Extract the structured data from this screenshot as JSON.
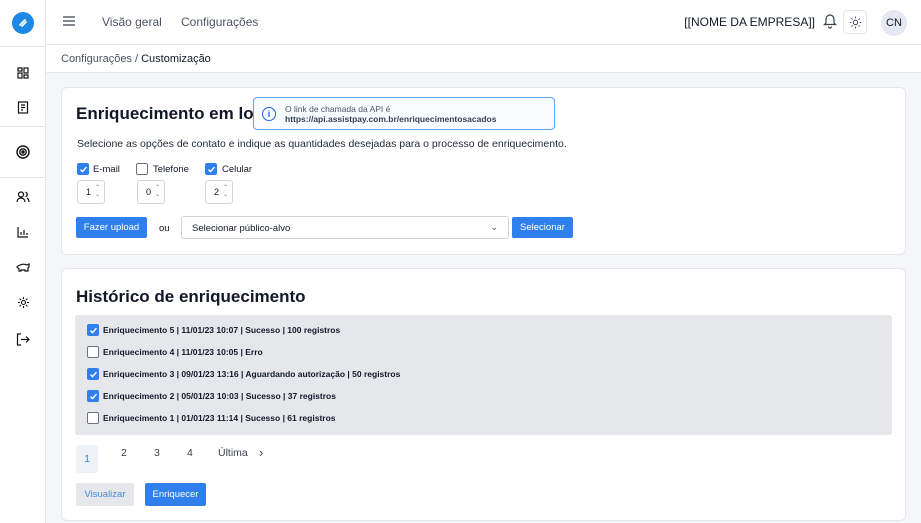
{
  "topbar": {
    "nav": [
      "Visão geral",
      "Configurações"
    ],
    "company": "[[NOME DA EMPRESA]]",
    "avatar": "CN"
  },
  "sidebar": {
    "icons": [
      "logo-icon",
      "dashboard-icon",
      "invoice-icon",
      "target-icon",
      "users-icon",
      "chart-icon",
      "piggy-bank-icon",
      "settings-icon",
      "logout-icon"
    ]
  },
  "breadcrumb": {
    "parent": "Configurações",
    "separator": " / ",
    "current": "Customização"
  },
  "batch": {
    "title": "Enriquecimento em lote",
    "info_line1": "O link de chamada da API é",
    "info_url": "https://api.assistpay.com.br/enriquecimentosacados",
    "description": "Selecione as opções de contato e indique as quantidades desejadas para o processo de enriquecimento.",
    "options": [
      {
        "label": "E-mail",
        "checked": true,
        "qty": "1"
      },
      {
        "label": "Telefone",
        "checked": false,
        "qty": "0"
      },
      {
        "label": "Celular",
        "checked": true,
        "qty": "2"
      }
    ],
    "upload_label": "Fazer upload",
    "or_label": "ou",
    "select_value": "Selecionar público-alvo",
    "select_button": "Selecionar"
  },
  "history": {
    "title": "Histórico de enriquecimento",
    "items": [
      {
        "text": "Enriquecimento 5 | 11/01/23 10:07 | Sucesso | 100 registros",
        "checked": true
      },
      {
        "text": "Enriquecimento 4 | 11/01/23 10:05 | Erro",
        "checked": false
      },
      {
        "text": "Enriquecimento 3 | 09/01/23 13:16 | Aguardando autorização | 50 registros",
        "checked": true
      },
      {
        "text": "Enriquecimento 2 | 05/01/23 10:03 | Sucesso | 37 registros",
        "checked": true
      },
      {
        "text": "Enriquecimento 1 | 01/01/23 11:14 | Sucesso | 61 registros",
        "checked": false
      }
    ],
    "pages": [
      "1",
      "2",
      "3",
      "4"
    ],
    "last_label": "Última",
    "view_label": "Visualizar",
    "enrich_label": "Enriquecer"
  },
  "colors": {
    "accent": "#2f80ed",
    "logo": "#1e88e5"
  }
}
